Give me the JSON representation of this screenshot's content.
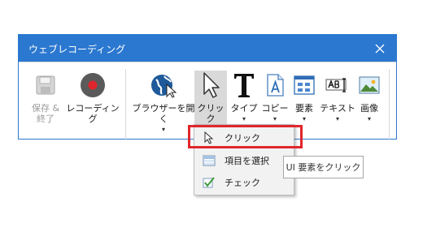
{
  "window": {
    "title": "ウェブレコーディング",
    "accent_color": "#2b78d0"
  },
  "ribbon": {
    "save_exit": {
      "label": "保存 &\n終了",
      "icon": "floppy-disk-icon",
      "enabled": false
    },
    "recording": {
      "label": "レコーディング",
      "icon": "record-icon"
    },
    "open_browser": {
      "label": "ブラウザーを開く",
      "icon": "globe-cursor-icon",
      "caret": "▾"
    },
    "click": {
      "label": "クリック",
      "icon": "cursor-arrow-icon",
      "caret": "▾",
      "active": true
    },
    "type": {
      "label": "タイプ",
      "icon": "text-t-icon",
      "caret": "▾"
    },
    "copy": {
      "label": "コピー",
      "icon": "copy-text-icon",
      "caret": "▾"
    },
    "element": {
      "label": "要素",
      "icon": "element-grid-icon",
      "caret": "▾"
    },
    "text": {
      "label": "テキスト",
      "icon": "text-ocr-icon",
      "caret": "▾"
    },
    "image": {
      "label": "画像",
      "icon": "image-icon",
      "caret": "▾"
    }
  },
  "click_menu": {
    "items": [
      {
        "label": "クリック",
        "icon": "cursor-arrow-icon"
      },
      {
        "label": "項目を選択",
        "icon": "list-select-icon"
      },
      {
        "label": "チェック",
        "icon": "checkbox-icon"
      }
    ]
  },
  "tooltip": {
    "text": "UI 要素をクリック"
  },
  "highlight_color": "#e0262c"
}
